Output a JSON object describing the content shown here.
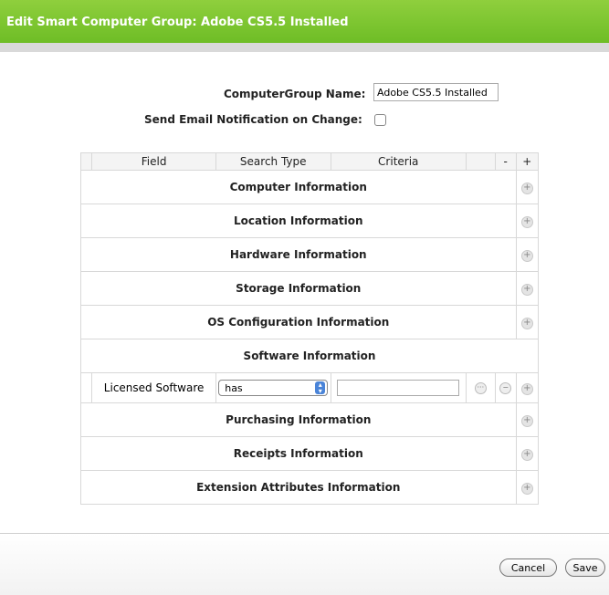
{
  "window": {
    "title": "Edit Smart Computer Group: Adobe CS5.5 Installed"
  },
  "form": {
    "name_label": "ComputerGroup Name:",
    "name_value": "Adobe CS5.5 Installed",
    "email_label": "Send Email Notification on Change:",
    "email_checked": false
  },
  "table": {
    "headers": {
      "field": "Field",
      "search_type": "Search Type",
      "criteria": "Criteria",
      "minus": "-",
      "plus": "+"
    },
    "sections": [
      "Computer Information",
      "Location Information",
      "Hardware Information",
      "Storage Information",
      "OS Configuration Information",
      "Software Information",
      "Purchasing Information",
      "Receipts Information",
      "Extension Attributes Information"
    ],
    "criterion": {
      "field": "Licensed Software",
      "search_type": "has",
      "value": ""
    }
  },
  "buttons": {
    "cancel": "Cancel",
    "save": "Save"
  }
}
